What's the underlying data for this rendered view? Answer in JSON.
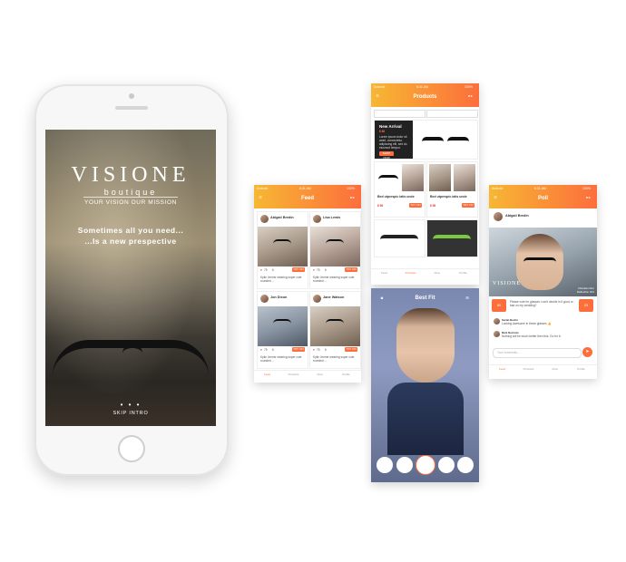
{
  "splash": {
    "logo": "VISIONE",
    "logo_sub": "boutique",
    "mission": "YOUR VISION OUR MISSION",
    "tagline_1": "Sometimes all you need...",
    "tagline_2": "...Is a new prespective",
    "dots": "• • •",
    "skip": "SKIP INTRO"
  },
  "status_bar": {
    "carrier": "Android",
    "time": "6:31 AM",
    "battery": "100%"
  },
  "feed": {
    "title": "Feed",
    "posts": [
      {
        "name": "Abigail Bredin",
        "likes": "75",
        "comments": "6",
        "button": "TRY ON",
        "text": "Kylie Jenner wearing super cute rounded ..."
      },
      {
        "name": "Lisa Lewis",
        "likes": "75",
        "comments": "6",
        "button": "TRY ON",
        "text": "Kylie Jenner wearing super cute rounded ..."
      },
      {
        "name": "Jon Dixon",
        "likes": "75",
        "comments": "6",
        "button": "TRY ON",
        "text": "Kylie Jenner wearing super cute rounded ..."
      },
      {
        "name": "Jane Watson",
        "likes": "75",
        "comments": "6",
        "button": "TRY ON",
        "text": "Kylie Jenner wearing super cute rounded ..."
      }
    ]
  },
  "products": {
    "title": "Products",
    "banner_title": "New Arrival",
    "banner_price": "$ 86",
    "banner_text": "Lorem ipsum dolor sit amet, consectetur adipiscing elit, sed do eiusmod tempor.",
    "banner_button": "SHOP NOW",
    "items": [
      {
        "name": "Bed utperspic iatis unde",
        "price": "$ 98",
        "button": "TRY ON"
      },
      {
        "name": "Bed utperspic iatis unde",
        "price": "$ 98",
        "button": "TRY ON"
      }
    ]
  },
  "poll": {
    "title": "Poll",
    "user": "Abigail Bredin",
    "watermark": "VISIONE",
    "caption": "Christian Dior\nReflection 201",
    "question": "Please vote for glasses i can't decide is it good or bad on my wedding?",
    "likes": "50",
    "dislikes": "23",
    "comments": [
      {
        "name": "Sarah Bodin",
        "text": "Looking Awesome in these glasses 👍"
      },
      {
        "name": "Nick Norindo",
        "text": "Nothing will be much better then this. Go for it."
      }
    ],
    "input_placeholder": "Your comments..."
  },
  "bestfit": {
    "title": "Best Fit"
  },
  "nav": [
    "Feed",
    "Products",
    "Chat",
    "Profile"
  ],
  "nav_active_feed": "Feed",
  "nav_active_products": "Products",
  "colors": {
    "accent": "#fc6e3c",
    "gradient_start": "#f7b733"
  }
}
